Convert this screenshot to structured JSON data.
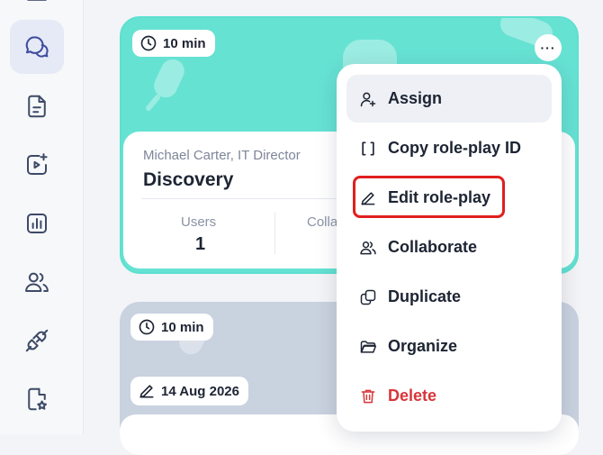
{
  "sidebar": {
    "items": [
      {
        "name": "chat-icon",
        "active": true
      },
      {
        "name": "document-icon",
        "active": false
      },
      {
        "name": "video-sparkle-icon",
        "active": false
      },
      {
        "name": "analytics-icon",
        "active": false
      },
      {
        "name": "users-icon",
        "active": false
      },
      {
        "name": "plug-icon",
        "active": false
      },
      {
        "name": "file-star-icon",
        "active": false
      }
    ]
  },
  "cards": [
    {
      "duration": "10 min",
      "persona": "Michael Carter, IT Director",
      "title": "Discovery",
      "stats": [
        {
          "label": "Users",
          "value": "1"
        },
        {
          "label": "Colla",
          "value": ""
        }
      ],
      "color": "#66e2d3"
    },
    {
      "duration": "10 min",
      "edited": "14 Aug 2026",
      "color": "#c9d2df"
    }
  ],
  "menu": {
    "more_label": "···",
    "items": [
      {
        "label": "Assign",
        "icon": "user-plus-icon"
      },
      {
        "label": "Copy role-play ID",
        "icon": "brackets-icon"
      },
      {
        "label": "Edit role-play",
        "icon": "pencil-icon"
      },
      {
        "label": "Collaborate",
        "icon": "users-icon"
      },
      {
        "label": "Duplicate",
        "icon": "duplicate-icon"
      },
      {
        "label": "Organize",
        "icon": "folder-icon"
      },
      {
        "label": "Delete",
        "icon": "trash-icon"
      }
    ]
  },
  "colors": {
    "accent": "#66e2d3",
    "danger": "#d8353a",
    "highlight": "#e01f1f"
  }
}
